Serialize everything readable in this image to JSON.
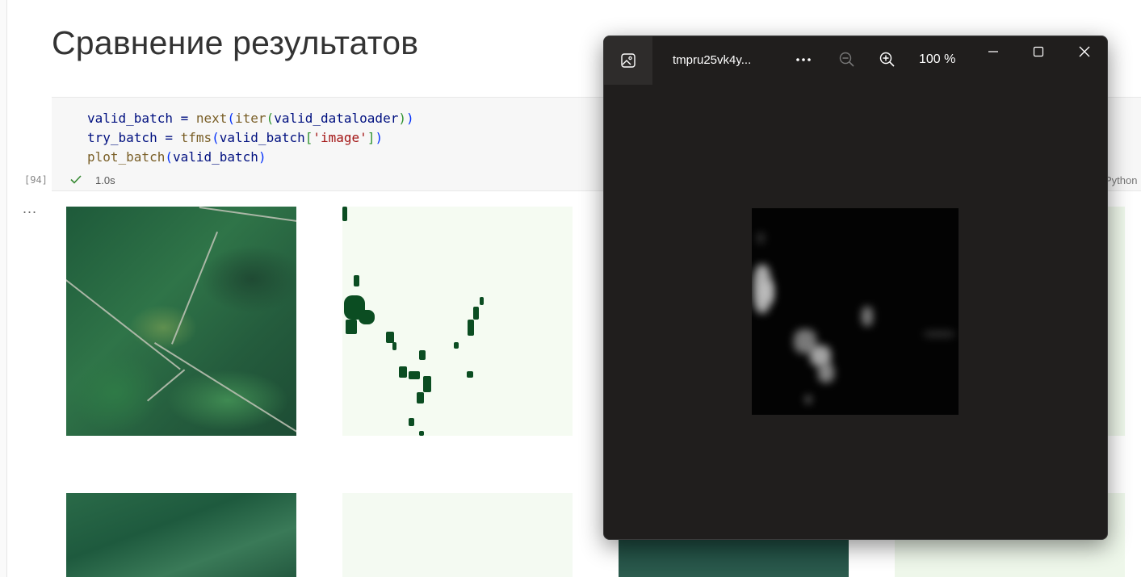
{
  "notebook": {
    "title": "Сравнение результатов",
    "cell": {
      "execution_count": "[94]",
      "exec_time": "1.0s",
      "language": "Python",
      "code_lines": {
        "l1a": "valid_batch = ",
        "l1b": "next",
        "l1c": "(",
        "l1d": "iter",
        "l1e": "(",
        "l1f": "valid_dataloader",
        "l1g": ")",
        "l1h": ")",
        "l2a": "try_batch = ",
        "l2b": "tfms",
        "l2c": "(",
        "l2d": "valid_batch",
        "l2e": "[",
        "l2f": "'image'",
        "l2g": "]",
        "l2h": ")",
        "l3a": "plot_batch",
        "l3b": "(",
        "l3c": "valid_batch",
        "l3d": ")"
      }
    },
    "output_menu": "..."
  },
  "viewer": {
    "file_name": "tmpru25vk4y...",
    "zoom": "100 %",
    "icons": [
      "image-icon",
      "more-icon",
      "zoom-out-icon",
      "zoom-in-icon",
      "minimize-icon",
      "maximize-icon",
      "close-icon"
    ]
  },
  "colors": {
    "viewer_bg": "#201e1d",
    "mask_fill": "#0b4d22",
    "accent_check": "#388a34"
  }
}
